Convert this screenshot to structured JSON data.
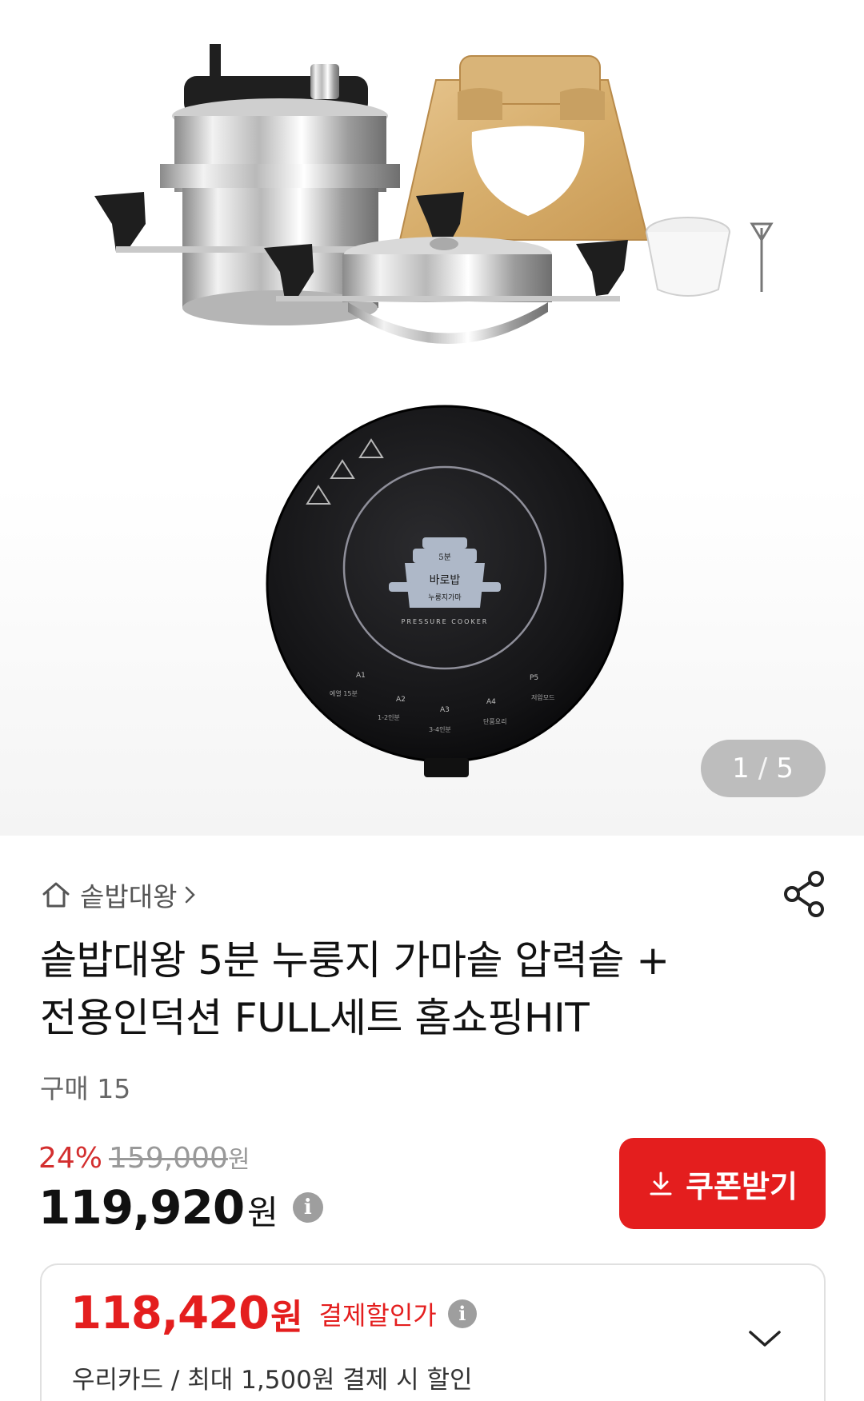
{
  "gallery": {
    "current_page": "1",
    "separator": "/",
    "total_pages": "5"
  },
  "store": {
    "name": "솥밥대왕"
  },
  "product": {
    "title_line1": "솥밥대왕 5분 누룽지 가마솥 압력솥 +",
    "title_line2": "전용인덕션 FULL세트 홈쇼핑HIT",
    "purchase_count": "구매 15"
  },
  "pricing": {
    "discount_rate": "24%",
    "original_price": "159,000",
    "original_unit": "원",
    "sale_price": "119,920",
    "sale_unit": "원",
    "info_icon": "i"
  },
  "coupon": {
    "label": "쿠폰받기"
  },
  "payment_discount": {
    "price": "118,420",
    "unit": "원",
    "label": "결제할인가",
    "info_icon": "i",
    "description": "우리카드 / 최대 1,500원 결제 시 할인"
  },
  "induction_labels": {
    "logo_top": "5분",
    "logo_main": "바로밥",
    "logo_sub": "누룽지가마",
    "logo_ring": "PRESSURE COOKER",
    "mode_a1": "A1",
    "mode_a2": "A2",
    "mode_a3": "A3",
    "mode_a4": "A4",
    "mode_p": "P5",
    "mode_a1_desc": "예열 15분",
    "mode_a2_desc": "1-2인분",
    "mode_a3_desc": "3-4인분",
    "mode_a4_desc": "단품요리",
    "mode_p_desc": "저압모드"
  },
  "colors": {
    "accent_red": "#e41e1e",
    "discount_red": "#d32f2f",
    "indicator_bg": "#bdbdbd"
  },
  "icons": {
    "home": "home-icon",
    "chevron": "chevron-right-icon",
    "share": "share-icon",
    "download": "download-icon",
    "info": "info-icon",
    "expand": "chevron-down-icon"
  }
}
